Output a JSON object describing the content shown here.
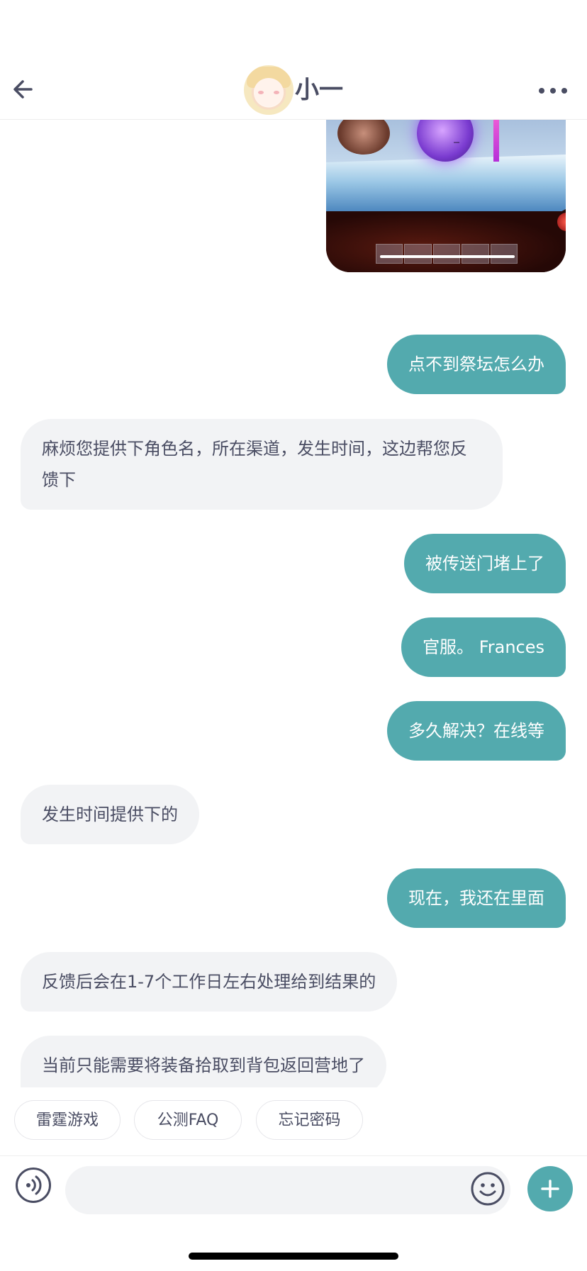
{
  "header": {
    "contact_name": "小一"
  },
  "messages": [
    {
      "type": "image",
      "from": "me"
    },
    {
      "from": "me",
      "text": "点不到祭坛怎么办"
    },
    {
      "from": "agent",
      "text": "麻烦您提供下角色名，所在渠道，发生时间，这边帮您反馈下"
    },
    {
      "from": "me",
      "text": "被传送门堵上了"
    },
    {
      "from": "me",
      "text": "官服。 Frances"
    },
    {
      "from": "me",
      "text": "多久解决？在线等"
    },
    {
      "from": "agent",
      "text": "发生时间提供下的"
    },
    {
      "from": "me",
      "text": "现在，我还在里面"
    },
    {
      "from": "agent",
      "text": "反馈后会在1-7个工作日左右处理给到结果的"
    },
    {
      "from": "agent",
      "text": "当前只能需要将装备拾取到背包返回营地了"
    }
  ],
  "quick_replies": [
    "雷霆游戏",
    "公测FAQ",
    "忘记密码"
  ],
  "input": {
    "value": "",
    "placeholder": ""
  },
  "icons": {
    "back": "back-arrow-icon",
    "more": "more-dots-icon",
    "voice": "voice-icon",
    "emoji": "emoji-icon",
    "plus": "plus-icon"
  },
  "colors": {
    "outgoing_bubble": "#53aaae",
    "incoming_bubble": "#f2f3f5",
    "text": "#4a4d63"
  }
}
